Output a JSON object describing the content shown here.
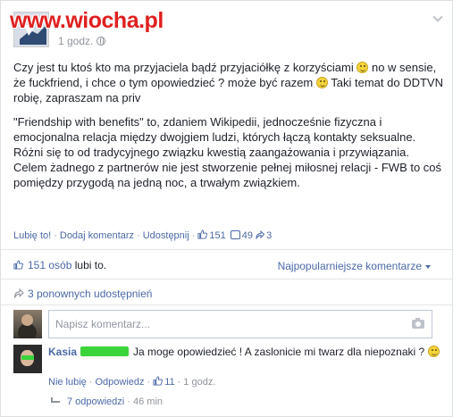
{
  "watermark": "www.wiocha.pl",
  "post": {
    "time": "1 godz.",
    "paragraph1_a": "Czy jest tu ktoś kto ma przyjaciela bądź przyjaciółkę z korzyściami",
    "paragraph1_b": "no w sensie, że fuckfriend, i chce o tym opowiedzieć ? może być razem",
    "paragraph1_c": "Taki temat do DDTVN robię, zapraszam na priv",
    "paragraph2": "\"Friendship with benefits\" to, zdaniem Wikipedii, jednocześnie fizyczna i emocjonalna relacja między dwojgiem ludzi, których łączą kontakty seksualne. Różni się to od tradycyjnego związku kwestią zaangażowania i przywiązania. Celem żadnego z partnerów nie jest stworzenie pełnej miłosnej relacji - FWB to coś pomiędzy przygodą na jedną noc, a trwałym związkiem."
  },
  "actions": {
    "like": "Lubię to!",
    "comment": "Dodaj komentarz",
    "share": "Udostępnij",
    "like_count": "151",
    "comment_count": "49",
    "share_count": "3"
  },
  "likes_summary": {
    "count_text": "151 osób",
    "suffix": "lubi to."
  },
  "sort_label": "Najpopularniejsze komentarze",
  "shares_summary": "3 ponownych udostępnień",
  "composer": {
    "placeholder": "Napisz komentarz..."
  },
  "comment": {
    "author": "Kasia",
    "text": "Ja moge opowiedzieć ! A zaslonicie mi twarz dla niepoznaki ?",
    "unlike": "Nie lubię",
    "reply": "Odpowiedz",
    "like_count": "11",
    "time": "1 godz."
  },
  "replies": {
    "label": "7 odpowiedzi",
    "time": "46 min"
  },
  "colors": {
    "link": "#4b6aa8",
    "watermark": "#e02020",
    "censor": "#3bd43b",
    "meta": "#90949c"
  }
}
